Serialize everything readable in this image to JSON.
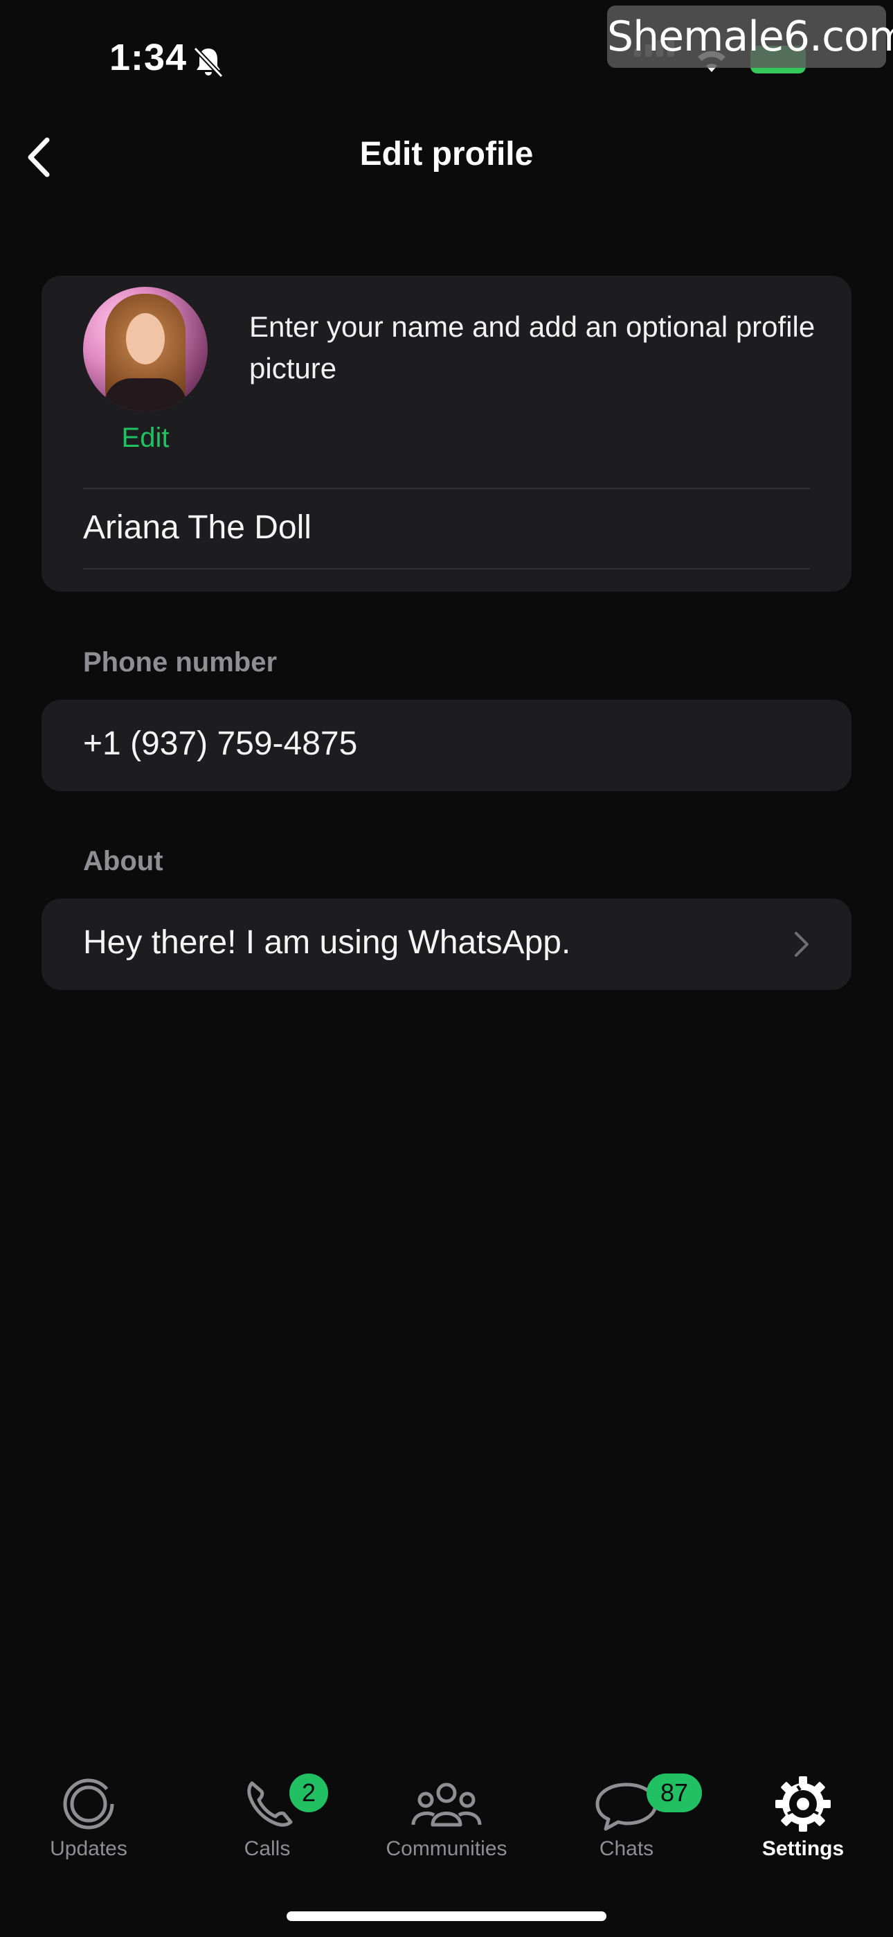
{
  "status_bar": {
    "time": "1:34",
    "battery": "80",
    "watermark": "Shemale6.com"
  },
  "header": {
    "title": "Edit profile"
  },
  "profile": {
    "hint": "Enter your name and add an optional profile picture",
    "edit_label": "Edit",
    "name": "Ariana The Doll"
  },
  "phone": {
    "label": "Phone number",
    "value": "+1 (937) 759-4875"
  },
  "about": {
    "label": "About",
    "value": "Hey there! I am using WhatsApp."
  },
  "tabs": [
    {
      "label": "Updates",
      "icon": "updates-icon",
      "active": false
    },
    {
      "label": "Calls",
      "icon": "phone-icon",
      "badge": "2",
      "active": false
    },
    {
      "label": "Communities",
      "icon": "communities-icon",
      "active": false
    },
    {
      "label": "Chats",
      "icon": "chat-bubble-icon",
      "badge": "87",
      "active": false
    },
    {
      "label": "Settings",
      "icon": "gear-icon",
      "active": true
    }
  ],
  "colors": {
    "accent": "#21c063",
    "background": "#0b0b0c",
    "card": "#1d1d1f",
    "secondary_text": "#8e8e93"
  }
}
